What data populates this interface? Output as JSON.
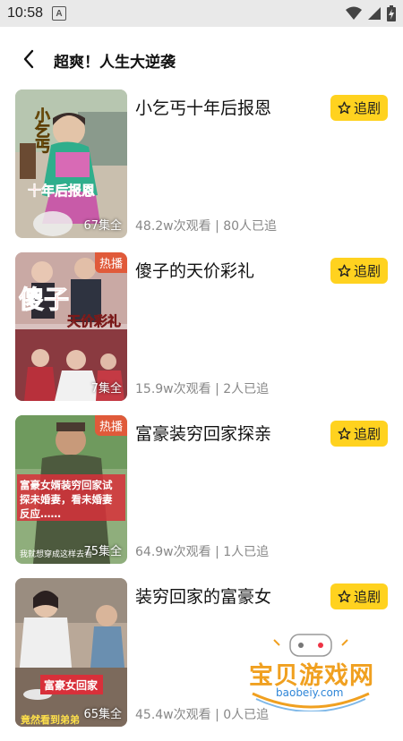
{
  "status": {
    "time": "10:58",
    "a_icon": "A"
  },
  "header": {
    "title": "超爽！人生大逆袭"
  },
  "follow_label": "追剧",
  "items": [
    {
      "title": "小乞丐十年后报恩",
      "meta": "48.2w次观看 | 80人已追",
      "episodes": "67集全",
      "hot": ""
    },
    {
      "title": "傻子的天价彩礼",
      "meta": "15.9w次观看 | 2人已追",
      "episodes": "7集全",
      "hot": "热播"
    },
    {
      "title": "富豪装穷回家探亲",
      "meta": "64.9w次观看 | 1人已追",
      "episodes": "75集全",
      "hot": "热播"
    },
    {
      "title": "装穷回家的富豪女",
      "meta": "45.4w次观看 | 0人已追",
      "episodes": "65集全",
      "hot": ""
    }
  ],
  "thumb_text": {
    "t1_a": "小乞丐",
    "t1_b": "十年后报恩",
    "t2_a": "傻子",
    "t2_b": "天价彩礼",
    "t3_a": "富豪女婿装穷回家试",
    "t3_b": "探未婚妻，看未婚妻",
    "t3_c": "反应……",
    "t3_d": "我就想穿成这样去看",
    "t4_a": "富豪女回家",
    "t4_b": "竟然看到弟弟"
  },
  "watermark": {
    "text": "宝贝游戏网",
    "url": "baobeiy.com"
  }
}
